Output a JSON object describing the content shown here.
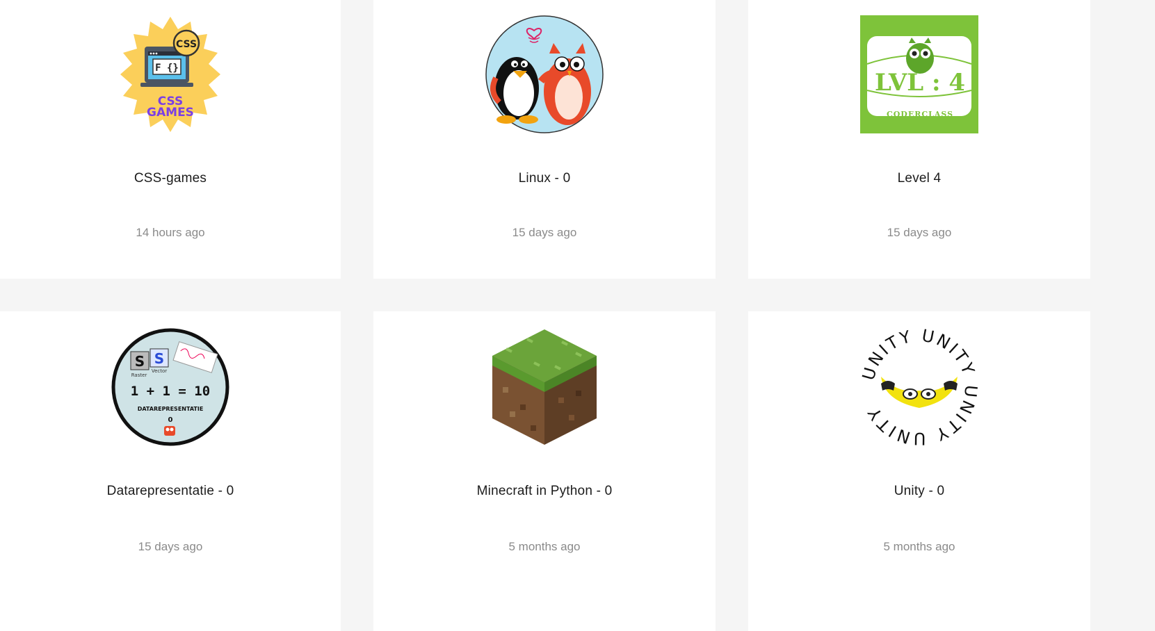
{
  "courses": [
    {
      "title": "CSS-games",
      "updated": "14 hours ago",
      "icon": "css-games-badge-icon",
      "badge_text": "CSS",
      "logo_line1": "CSS",
      "logo_line2": "GAMES"
    },
    {
      "title": "Linux - 0",
      "updated": "15 days ago",
      "icon": "penguin-owl-icon"
    },
    {
      "title": "Level 4",
      "updated": "15 days ago",
      "icon": "level4-owl-icon",
      "logo_text": "LVL : 4",
      "logo_sub": "CODERCLASS"
    },
    {
      "title": "Datarepresentatie - 0",
      "updated": "15 days ago",
      "icon": "datarepresentatie-icon",
      "logo_eq": "1 + 1 = 10",
      "logo_text": "DATAREPRESENTATIE",
      "logo_num": "0",
      "logo_raster": "Raster",
      "logo_vector": "Vector"
    },
    {
      "title": "Minecraft in Python - 0",
      "updated": "5 months ago",
      "icon": "grass-block-icon"
    },
    {
      "title": "Unity - 0",
      "updated": "5 months ago",
      "icon": "unity-owl-icon",
      "ring_text": "UNITY UNITY UNITY UNITY"
    }
  ],
  "colors": {
    "background": "#f5f5f5",
    "card": "#ffffff",
    "title": "#1c1c1c",
    "timestamp": "#8a8a8a"
  }
}
